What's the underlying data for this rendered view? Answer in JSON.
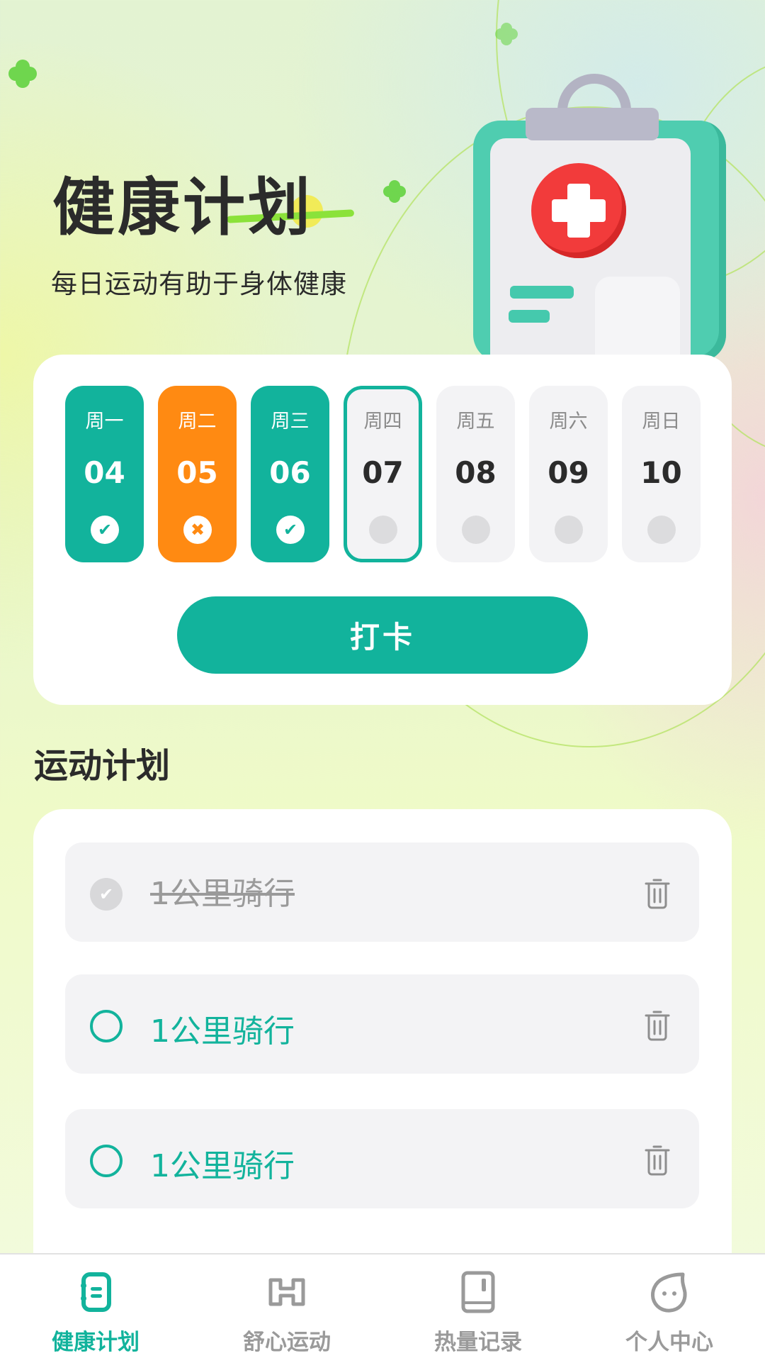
{
  "header": {
    "title": "健康计划",
    "subtitle": "每日运动有助于身体健康"
  },
  "colors": {
    "accent": "#12b39c",
    "missed": "#ff8a12",
    "inactive": "#9a9a9a"
  },
  "week": {
    "days": [
      {
        "label": "周一",
        "date": "04",
        "status": "done",
        "status_icon": "✔"
      },
      {
        "label": "周二",
        "date": "05",
        "status": "missed",
        "status_icon": "✖"
      },
      {
        "label": "周三",
        "date": "06",
        "status": "done",
        "status_icon": "✔"
      },
      {
        "label": "周四",
        "date": "07",
        "status": "today",
        "status_icon": ""
      },
      {
        "label": "周五",
        "date": "08",
        "status": "upcoming",
        "status_icon": ""
      },
      {
        "label": "周六",
        "date": "09",
        "status": "upcoming",
        "status_icon": ""
      },
      {
        "label": "周日",
        "date": "10",
        "status": "upcoming",
        "status_icon": ""
      }
    ],
    "checkin_button": "打卡"
  },
  "plan": {
    "section_title": "运动计划",
    "items": [
      {
        "text": "1公里骑行",
        "completed": true,
        "check_icon": "✔"
      },
      {
        "text": "1公里骑行",
        "completed": false,
        "check_icon": ""
      },
      {
        "text": "1公里骑行",
        "completed": false,
        "check_icon": ""
      }
    ]
  },
  "nav": {
    "items": [
      {
        "label": "健康计划",
        "icon": "plan-icon",
        "active": true
      },
      {
        "label": "舒心运动",
        "icon": "exercise-icon",
        "active": false
      },
      {
        "label": "热量记录",
        "icon": "record-book-icon",
        "active": false
      },
      {
        "label": "个人中心",
        "icon": "profile-face-icon",
        "active": false
      }
    ]
  }
}
